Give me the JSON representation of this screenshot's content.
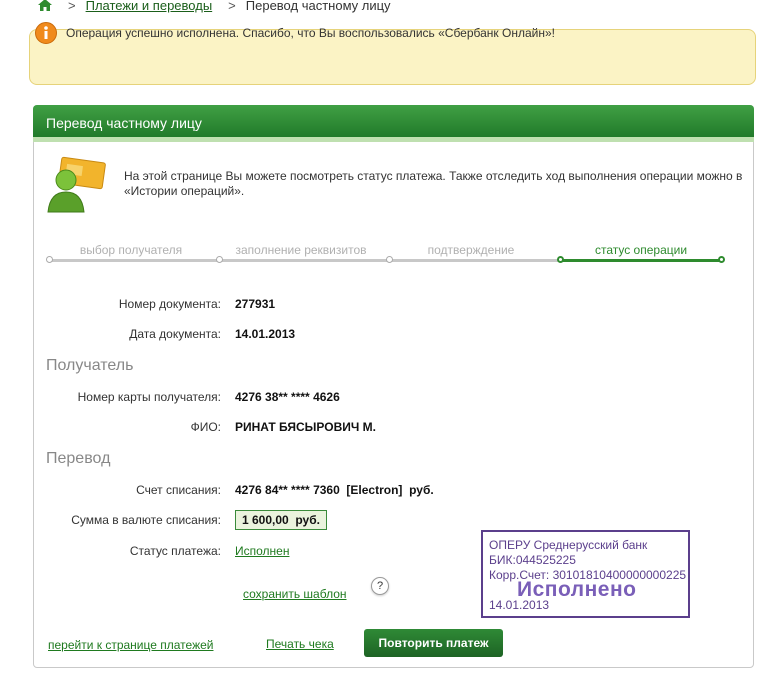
{
  "breadcrumb": {
    "home_icon": "home-icon",
    "separator": ">",
    "link": "Платежи и переводы",
    "current": "Перевод частному лицу"
  },
  "alert": {
    "icon": "info-icon",
    "text": "Операция успешно исполнена. Спасибо, что Вы воспользовались «Сбербанк Онлайн»!"
  },
  "panel": {
    "title": "Перевод частному лицу",
    "intro": "На этой странице Вы можете посмотреть статус платежа. Также отследить ход выполнения операции можно в «Истории операций»."
  },
  "steps": [
    {
      "label": "выбор получателя",
      "active": false
    },
    {
      "label": "заполнение реквизитов",
      "active": false
    },
    {
      "label": "подтверждение",
      "active": false
    },
    {
      "label": "статус операции",
      "active": true
    }
  ],
  "document": {
    "number_label": "Номер документа:",
    "number": "277931",
    "date_label": "Дата документа:",
    "date": "14.01.2013"
  },
  "recipient": {
    "heading": "Получатель",
    "card_label": "Номер карты получателя:",
    "card": "4276 38** **** 4626",
    "name_label": "ФИО:",
    "name": "РИНАТ БЯСЫРОВИЧ М."
  },
  "transfer": {
    "heading": "Перевод",
    "account_label": "Счет списания:",
    "account": "4276 84** **** 7360  [Electron]  руб.",
    "amount_label": "Сумма в валюте списания:",
    "amount": "1 600,00  руб.",
    "status_label": "Статус платежа:",
    "status": "Исполнен"
  },
  "actions": {
    "save_template": "сохранить шаблон",
    "help": "?",
    "go_payments": "перейти к странице платежей",
    "print": "Печать чека",
    "repeat": "Повторить платеж"
  },
  "stamp": {
    "bank": "ОПЕРУ Среднерусский банк",
    "bik": "БИК:044525225",
    "corr": "Корр.Счет: 30101810400000000225",
    "status": "Исполнено",
    "date": "14.01.2013"
  },
  "colors": {
    "accent_green": "#217a2a",
    "alert_bg": "#fbf3c5",
    "stamp": "#5b3f8c"
  }
}
